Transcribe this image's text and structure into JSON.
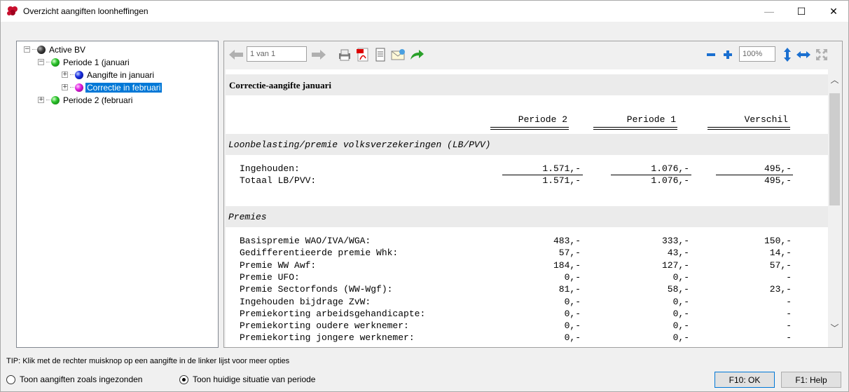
{
  "window": {
    "title": "Overzicht aangiften loonheffingen",
    "minimize": "—",
    "maximize": "☐",
    "close": "✕"
  },
  "tree": {
    "nodes": [
      {
        "label": "Active BV",
        "ball": "black",
        "expander": "−",
        "level": 0
      },
      {
        "label": "Periode 1 (januari",
        "ball": "green",
        "expander": "−",
        "level": 1
      },
      {
        "label": "Aangifte in januari",
        "ball": "blue",
        "expander": "+",
        "level": 2
      },
      {
        "label": "Correctie in februari",
        "ball": "magenta",
        "expander": "+",
        "level": 2,
        "selected": true
      },
      {
        "label": "Periode 2 (februari",
        "ball": "green",
        "expander": "+",
        "level": 1
      }
    ]
  },
  "toolbar": {
    "page_indicator": "1 van 1",
    "zoom": "100%",
    "icons": [
      "back-arrow-icon",
      "forward-arrow-icon",
      "printer-icon",
      "pdf-icon",
      "document-icon",
      "email-icon",
      "export-arrow-icon",
      "zoom-out-icon",
      "zoom-in-icon",
      "fit-height-icon",
      "fit-width-icon",
      "full-page-icon"
    ]
  },
  "report": {
    "title": "Correctie-aangifte januari",
    "columns": [
      "Periode 2",
      "Periode 1",
      "Verschil"
    ],
    "section1": {
      "title": "Loonbelasting/premie volksverzekeringen (LB/PVV)",
      "rows": [
        {
          "label": "Ingehouden:",
          "values": [
            "1.571,-",
            "1.076,-",
            "495,-"
          ]
        },
        {
          "label": "Totaal LB/PVV:",
          "values": [
            "1.571,-",
            "1.076,-",
            "495,-"
          ]
        }
      ]
    },
    "section2": {
      "title": "Premies",
      "rows": [
        {
          "label": "Basispremie WAO/IVA/WGA:",
          "values": [
            "483,-",
            "333,-",
            "150,-"
          ]
        },
        {
          "label": "Gedifferentieerde premie Whk:",
          "values": [
            "57,-",
            "43,-",
            "14,-"
          ]
        },
        {
          "label": "Premie WW Awf:",
          "values": [
            "184,-",
            "127,-",
            "57,-"
          ]
        },
        {
          "label": "Premie UFO:",
          "values": [
            "0,-",
            "0,-",
            "-"
          ]
        },
        {
          "label": "Premie Sectorfonds (WW-Wgf):",
          "values": [
            "81,-",
            "58,-",
            "23,-"
          ]
        },
        {
          "label": "Ingehouden bijdrage ZvW:",
          "values": [
            "0,-",
            "0,-",
            "-"
          ]
        },
        {
          "label": "Premiekorting arbeidsgehandicapte:",
          "values": [
            "0,-",
            "0,-",
            "-"
          ]
        },
        {
          "label": "Premiekorting oudere werknemer:",
          "values": [
            "0,-",
            "0,-",
            "-"
          ]
        },
        {
          "label": "Premiekorting jongere werknemer:",
          "values": [
            "0,-",
            "0,-",
            "-"
          ]
        }
      ]
    }
  },
  "footer": {
    "tip": "TIP: Klik met de rechter muisknop op een aangifte in de linker lijst voor meer opties",
    "radio1": "Toon aangiften zoals ingezonden",
    "radio2": "Toon huidige situatie van periode",
    "ok_button": "F10: OK",
    "help_button": "F1: Help"
  },
  "colors": {
    "selection": "#0078d7",
    "app_icon": "#c8102e"
  }
}
